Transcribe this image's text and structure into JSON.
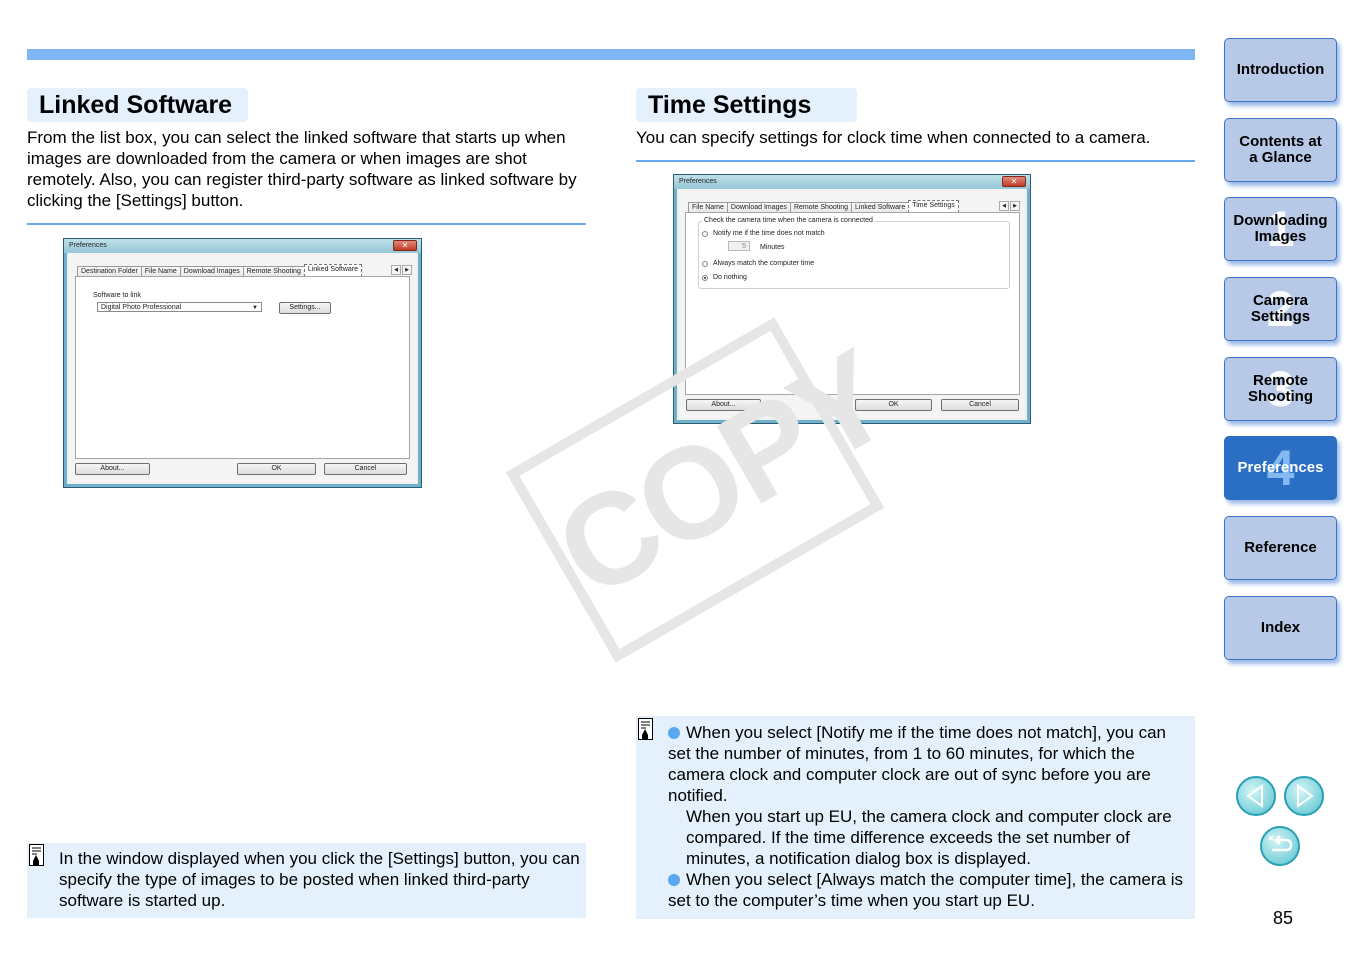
{
  "left": {
    "title": "Linked Software",
    "intro": "From the list box, you can select the linked software that starts up when images are downloaded from the camera or when images are shot remotely. Also, you can register third-party software as linked software by clicking the [Settings] button.",
    "dialog": {
      "title": "Preferences",
      "tabs": [
        "Destination Folder",
        "File Name",
        "Download Images",
        "Remote Shooting",
        "Linked Software"
      ],
      "active_tab": "Linked Software",
      "software_label": "Software to link",
      "software_value": "Digital Photo Professional",
      "settings_btn": "Settings...",
      "about_btn": "About...",
      "ok_btn": "OK",
      "cancel_btn": "Cancel"
    },
    "note": "In the window displayed when you click the [Settings] button, you can specify the type of images to be posted when linked third-party software is started up."
  },
  "right": {
    "title": "Time Settings",
    "intro": "You can specify settings for clock time when connected to a camera.",
    "dialog": {
      "title": "Preferences",
      "tabs": [
        "File Name",
        "Download Images",
        "Remote Shooting",
        "Linked Software",
        "Time Settings"
      ],
      "active_tab": "Time Settings",
      "group_label": "Check the camera time when the camera is connected",
      "opt_notify": "Notify me if the time does not match",
      "minutes_value": "5",
      "minutes_label": "Minutes",
      "opt_match": "Always match the computer time",
      "opt_nothing": "Do nothing",
      "selected": "Do nothing",
      "about_btn": "About...",
      "ok_btn": "OK",
      "cancel_btn": "Cancel"
    },
    "notes": [
      "When you select [Notify me if the time does not match], you can set the number of minutes, from 1 to 60 minutes, for which the camera clock and computer clock are out of sync before you are notified.",
      "When you start up EU, the camera clock and computer clock are compared. If the time difference exceeds the set number of minutes, a notification dialog box is displayed.",
      "When you select [Always match the computer time], the camera is set to the computer’s time when you start up EU."
    ]
  },
  "watermark": "COPY",
  "nav": [
    {
      "label": "Introduction",
      "num": ""
    },
    {
      "label": "Contents at a Glance",
      "num": ""
    },
    {
      "label": "Downloading Images",
      "num": "1"
    },
    {
      "label": "Camera Settings",
      "num": "2"
    },
    {
      "label": "Remote Shooting",
      "num": "3"
    },
    {
      "label": "Preferences",
      "num": "4",
      "active": true
    },
    {
      "label": "Reference",
      "num": ""
    },
    {
      "label": "Index",
      "num": ""
    }
  ],
  "page_number": "85",
  "colors": {
    "accent": "#7fb5f5",
    "note_bg": "#e4f0fc",
    "nav_active": "#2a6fc4",
    "nav_bg": "#b7c9e6"
  }
}
